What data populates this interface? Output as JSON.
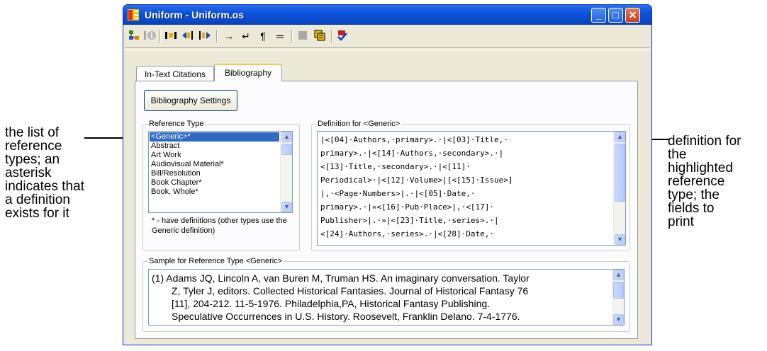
{
  "window": {
    "title": "Uniform - Uniform.os",
    "controls": {
      "minimize": "_",
      "maximize": "□",
      "close": "✕"
    }
  },
  "toolbar": {
    "icons": [
      "tree-icon",
      "info-icon",
      "insert-field-icon",
      "move-left-icon",
      "move-right-icon",
      "arrow-icon",
      "return-icon",
      "pilcrow-icon",
      "equals-icon",
      "block-icon",
      "grid-icon",
      "check-icon"
    ],
    "glyphs": {
      "arrow": "→",
      "return": "↵",
      "pilcrow": "¶",
      "equals": "═"
    }
  },
  "tabs": [
    {
      "label": "In-Text Citations",
      "active": false
    },
    {
      "label": "Bibliography",
      "active": true
    }
  ],
  "bibliography_settings_button": "Bibliography Settings",
  "reference_type": {
    "legend": "Reference Type",
    "items": [
      "<Generic>*",
      "Abstract",
      "Art Work",
      "Audiovisual Material*",
      "Bill/Resolution",
      "Book Chapter*",
      "Book, Whole*"
    ],
    "selected_index": 0,
    "note": "* - have definitions (other types use the Generic definition)"
  },
  "definition": {
    "legend": "Definition for <Generic>",
    "lines": [
      "|<[04]·Authors,·primary>.·|<[03]·Title,·",
      "primary>.·|<[14]·Authors,·secondary>.·|",
      "<[13]·Title,·secondary>.·|<[11]·",
      "Periodical>·|<[12]·Volume>|[<[15]·Issue>]",
      "|,·<Page·Numbers>|.·|<[05]·Date,·",
      "primary>.·|«<[16]·Pub·Place>|,·<[17]·",
      "Publisher>|.·»|<[23]·Title,·series>.·|",
      "<[24]·Authors,·series>.·|<[28]·Date,·"
    ]
  },
  "sample": {
    "legend": "Sample for Reference Type <Generic>",
    "lines": [
      "(1)  Adams JQ, Lincoln A, van Buren M, Truman HS. An imaginary conversation. Taylor",
      "Z, Tyler J, editors. Collected Historical Fantasies. Journal of Historical Fantasy 76",
      "[11], 204-212. 11-5-1976. Philadelphia,PA, Historical Fantasy Publishing.",
      "Speculative Occurrences in U.S. History. Roosevelt, Franklin Delano. 7-4-1776."
    ]
  },
  "callouts": {
    "left": "the list of\nreference\ntypes; an\nasterisk\nindicates that\na definition\nexists for it",
    "right": "definition for\nthe\nhighlighted\nreference\ntype; the\nfields to\nprint"
  }
}
